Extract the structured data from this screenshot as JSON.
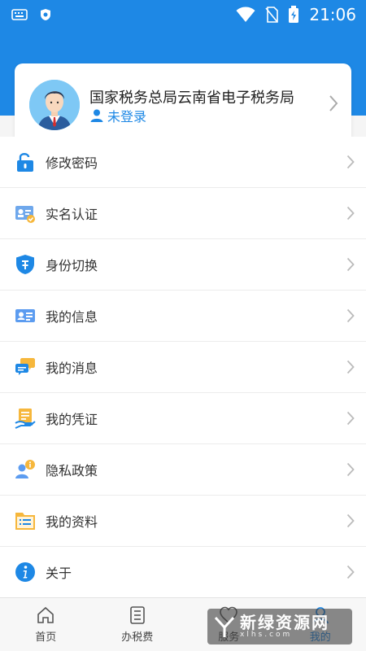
{
  "status_bar": {
    "time": "21:06"
  },
  "profile": {
    "org_name": "国家税务总局云南省电子税务局",
    "login_status": "未登录"
  },
  "menu": {
    "items": [
      {
        "label": "修改密码",
        "icon": "lock-icon"
      },
      {
        "label": "实名认证",
        "icon": "id-verify-icon"
      },
      {
        "label": "身份切换",
        "icon": "shield-switch-icon"
      },
      {
        "label": "我的信息",
        "icon": "id-card-icon"
      },
      {
        "label": "我的消息",
        "icon": "chat-icon"
      },
      {
        "label": "我的凭证",
        "icon": "voucher-icon"
      },
      {
        "label": "隐私政策",
        "icon": "privacy-icon"
      },
      {
        "label": "我的资料",
        "icon": "document-icon"
      },
      {
        "label": "关于",
        "icon": "info-icon"
      }
    ]
  },
  "bottom_nav": {
    "tabs": [
      {
        "label": "首页",
        "icon": "home-icon"
      },
      {
        "label": "办税费",
        "icon": "list-icon"
      },
      {
        "label": "服务",
        "icon": "service-icon"
      },
      {
        "label": "我的",
        "icon": "person-icon"
      }
    ]
  },
  "watermark": {
    "title": "新绿资源网",
    "subtitle": "xlhs.com"
  },
  "colors": {
    "primary": "#1e88e5",
    "background": "#f5f5f5"
  }
}
